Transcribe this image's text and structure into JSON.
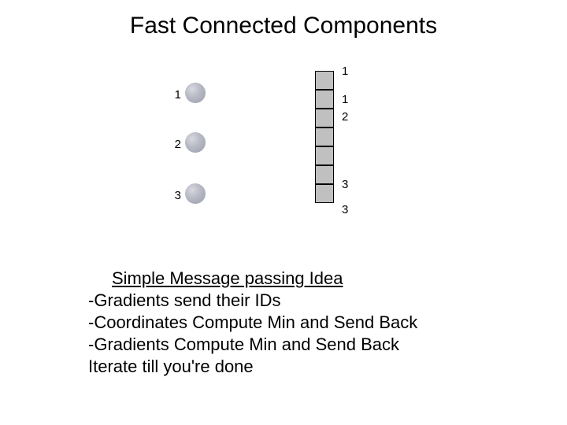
{
  "title": "Fast Connected Components",
  "dots": {
    "labels": [
      "1",
      "2",
      "3"
    ]
  },
  "cells": {
    "count": 7,
    "labels": {
      "top": "1",
      "second": "1",
      "third": "2",
      "sixth": "3",
      "below": "3"
    }
  },
  "notes": {
    "heading": "Simple Message passing Idea",
    "lines": [
      "-Gradients send their IDs",
      "-Coordinates Compute Min and Send Back",
      "-Gradients Compute Min and Send Back",
      "Iterate till you're done"
    ]
  }
}
